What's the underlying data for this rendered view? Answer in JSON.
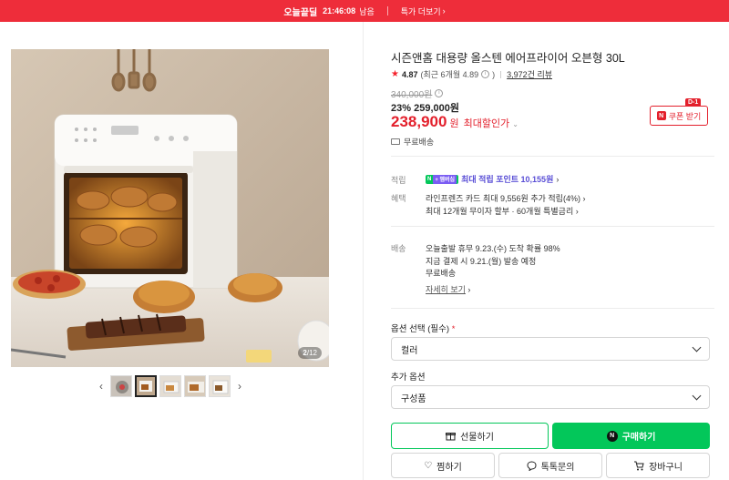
{
  "banner": {
    "brand": "오늘끝딜",
    "timer": "21:46:08",
    "suffix": "남음",
    "more": "특가 더보기",
    "color": "#ee2d3a"
  },
  "gallery": {
    "counter_current": "2",
    "counter_total": "/12"
  },
  "product": {
    "title": "시즌앤홈 대용량 올스텐 에어프라이어 오븐형 30L",
    "rating": "4.87",
    "rating_recent": "(최근 6개월 4.89",
    "review_count": "3,972건 리뷰",
    "original_price": "340,000원",
    "sale_discount": "23%",
    "sale_price": "259,000원",
    "best_price": "238,900",
    "best_won": "원",
    "best_label": "최대할인가",
    "free_shipping": "무료배송",
    "coupon_label": "쿠폰 받기",
    "coupon_dday": "D-1"
  },
  "benefits": {
    "point_label": "적립",
    "point_badge_n": "N",
    "point_badge_plus": "+ 멤버십",
    "point_text": "최대 적립 포인트 10,155원",
    "benefit_label": "혜택",
    "benefit_line1": "라인프렌즈 카드 최대 9,556원 추가 적립(4%)",
    "benefit_line2": "최대 12개월 무이자 할부 · 60개월 특별금리"
  },
  "delivery": {
    "label": "배송",
    "line1": "오늘출발 휴무    9.23.(수) 도착 확률 98%",
    "line2": "지금 결제 시 9.21.(월) 발송 예정",
    "line3": "무료배송",
    "detail": "자세히 보기"
  },
  "options": {
    "required_label": "옵션 선택 (필수)",
    "required_mark": "*",
    "color_value": "컬러",
    "extra_label": "추가 옵션",
    "extra_value": "구성품"
  },
  "actions": {
    "gift": "선물하기",
    "buy": "구매하기",
    "wish": "찜하기",
    "talk": "톡톡문의",
    "cart": "장바구니",
    "accent": "#03c75a"
  }
}
